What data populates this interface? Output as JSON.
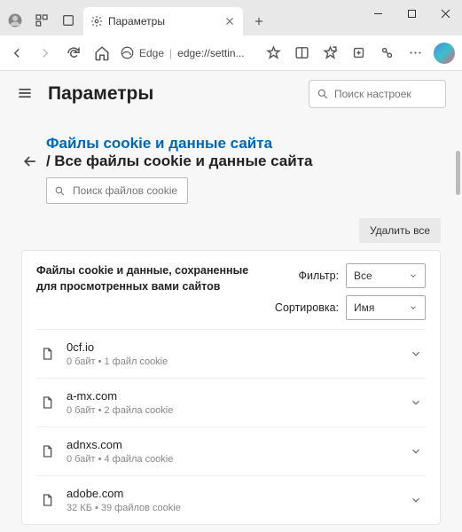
{
  "tab": {
    "title": "Параметры"
  },
  "address": {
    "brand": "Edge",
    "url": "edge://settin..."
  },
  "header": {
    "title": "Параметры",
    "search_placeholder": "Поиск настроек"
  },
  "breadcrumb": {
    "link": "Файлы cookie и данные сайта",
    "sep": "/",
    "current": "Все файлы cookie и данные сайта"
  },
  "cookie_search_placeholder": "Поиск файлов cookie",
  "delete_all": "Удалить все",
  "panel": {
    "description": "Файлы cookie и данные, сохраненные для просмотренных вами сайтов",
    "filter_label": "Фильтр:",
    "filter_value": "Все",
    "sort_label": "Сортировка:",
    "sort_value": "Имя"
  },
  "sites": [
    {
      "name": "0cf.io",
      "meta": "0 байт • 1 файл cookie"
    },
    {
      "name": "a-mx.com",
      "meta": "0 байт • 2 файла cookie"
    },
    {
      "name": "adnxs.com",
      "meta": "0 байт • 4 файла cookie"
    },
    {
      "name": "adobe.com",
      "meta": "32 КБ • 39 файлов cookie"
    }
  ]
}
